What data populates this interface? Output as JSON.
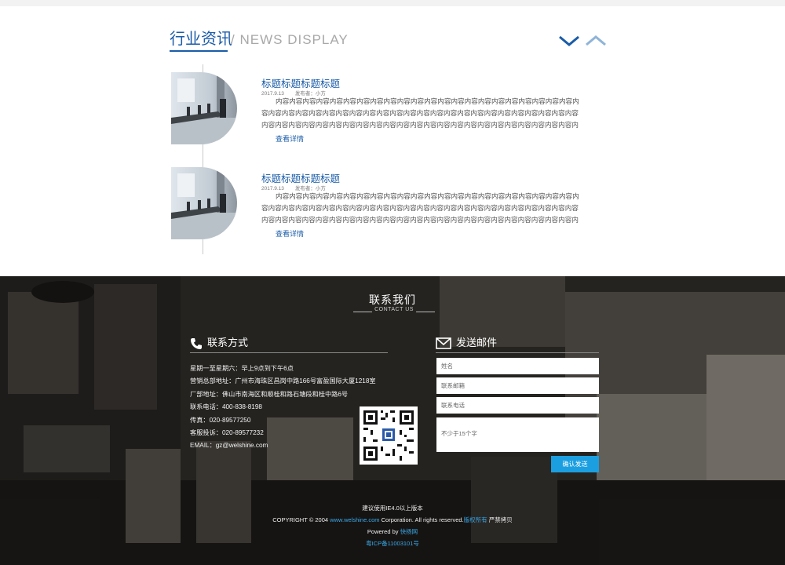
{
  "news": {
    "title_cn": "行业资讯",
    "title_sep": "/",
    "title_en": "NEWS DISPLAY",
    "items": [
      {
        "headline": "标题标题标题标题",
        "date": "2017.9.13",
        "author": "发布者：小方",
        "body": "内容内容内容内容内容内容内容内容内容内容内容内容内容内容内容内容内容内容内容内容内容内容内容内容内容内容内容内容内容内容内容内容内容内容内容内容内容内容内容内容内容内容内容内容内容内容内容内容内容内容内容内容内容内容内容内容内容内容内容内容内容内容内容内容内容内容内容内容内容内容内容 容内容内容内容内容内容内容...",
        "more": "查看详情"
      },
      {
        "headline": "标题标题标题标题",
        "date": "2017.9.13",
        "author": "发布者：小方",
        "body": "内容内容内容内容内容内容内容内容内容内容内容内容内容内容内容内容内容内容内容内容内容内容内容内容内容内容内容内容内容内容内容内容内容内容内容内容内容内容内容内容内容内容内容内容内容内容内容内容内容内容内容内容内容内容内容内容内容内容内容内容内容内容内容内容内容内容内容内容内容内容内容 容内容内容内容内容内容内容...",
        "more": "查看详情"
      }
    ]
  },
  "footer": {
    "contact_title": "联系我们",
    "contact_sub": "CONTACT US",
    "left_heading": "联系方式",
    "right_heading": "发送邮件",
    "contact_lines": [
      "星期一至星期六：早上9点到下午6点",
      "营销总部地址：广州市海珠区昌岗中路166号富盈国际大厦1218室",
      "厂部地址：佛山市南海区和顺桂和路石塘段和桂中路6号",
      "联系电话：400-838-8198",
      "传真：020-89577250",
      "客服投诉：020-89577232",
      "EMAIL：gz@welshine.com"
    ],
    "form": {
      "name_placeholder": "姓名",
      "email_placeholder": "联系邮箱",
      "phone_placeholder": "联系电话",
      "message_placeholder": "不少于15个字",
      "submit_label": "确认发送"
    },
    "bottom": {
      "browser_note": "建议使用IE4.0以上版本",
      "copyright_prefix": "COPYRIGHT © 2004",
      "site_link": "www.welshine.com",
      "copyright_middle": "Corporation. All rights reserved.",
      "rights_link": "版权所有",
      "copyright_suffix": "严禁拷贝",
      "powered_prefix": "Powered by",
      "powered_link": "快扬网",
      "icp": "粤ICP备11003101号"
    }
  },
  "colors": {
    "brand_blue": "#1a5ca8",
    "link_blue": "#39a9e8",
    "button_blue": "#1c9fe0"
  }
}
